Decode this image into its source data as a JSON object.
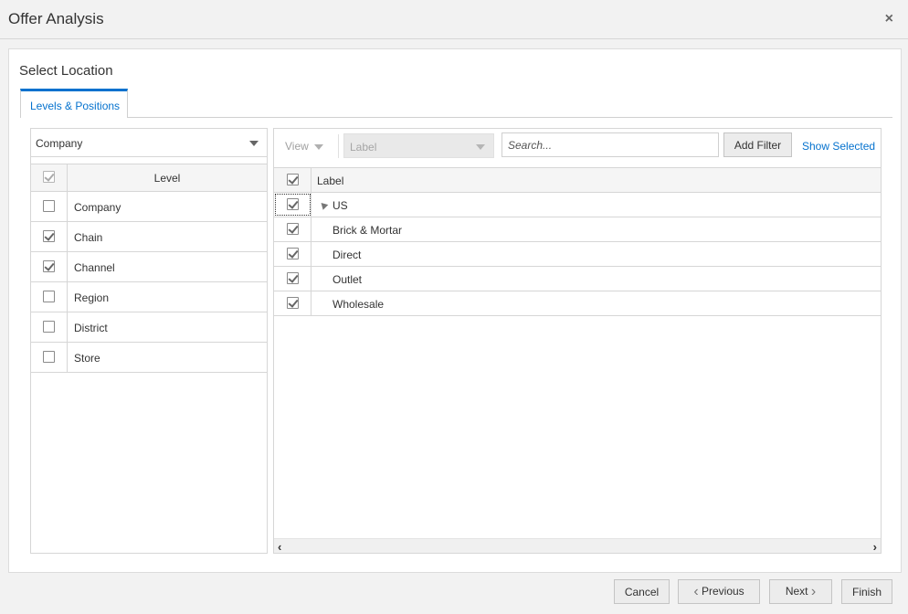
{
  "dialog": {
    "title": "Offer Analysis",
    "close": "×"
  },
  "section": {
    "title": "Select Location"
  },
  "tabs": [
    {
      "label": "Levels & Positions"
    }
  ],
  "left_panel": {
    "hierarchy_select": "Company",
    "table": {
      "header": "Level",
      "header_checked": true,
      "rows": [
        {
          "label": "Company",
          "checked": false
        },
        {
          "label": "Chain",
          "checked": true
        },
        {
          "label": "Channel",
          "checked": true
        },
        {
          "label": "Region",
          "checked": false
        },
        {
          "label": "District",
          "checked": false
        },
        {
          "label": "Store",
          "checked": false
        }
      ]
    }
  },
  "right_panel": {
    "toolbar": {
      "view_label": "View",
      "label_select": "Label",
      "search_placeholder": "Search...",
      "add_filter": "Add Filter",
      "show_selected": "Show Selected"
    },
    "table": {
      "header": "Label",
      "header_checked": true,
      "rows": [
        {
          "label": "US",
          "checked": true,
          "level": 0,
          "expanded": true
        },
        {
          "label": "Brick & Mortar",
          "checked": true,
          "level": 1
        },
        {
          "label": "Direct",
          "checked": true,
          "level": 1
        },
        {
          "label": "Outlet",
          "checked": true,
          "level": 1
        },
        {
          "label": "Wholesale",
          "checked": true,
          "level": 1
        }
      ]
    }
  },
  "footer": {
    "cancel": "Cancel",
    "previous": "Previous",
    "next": "Next",
    "finish": "Finish"
  },
  "colors": {
    "accent": "#0572ce"
  }
}
